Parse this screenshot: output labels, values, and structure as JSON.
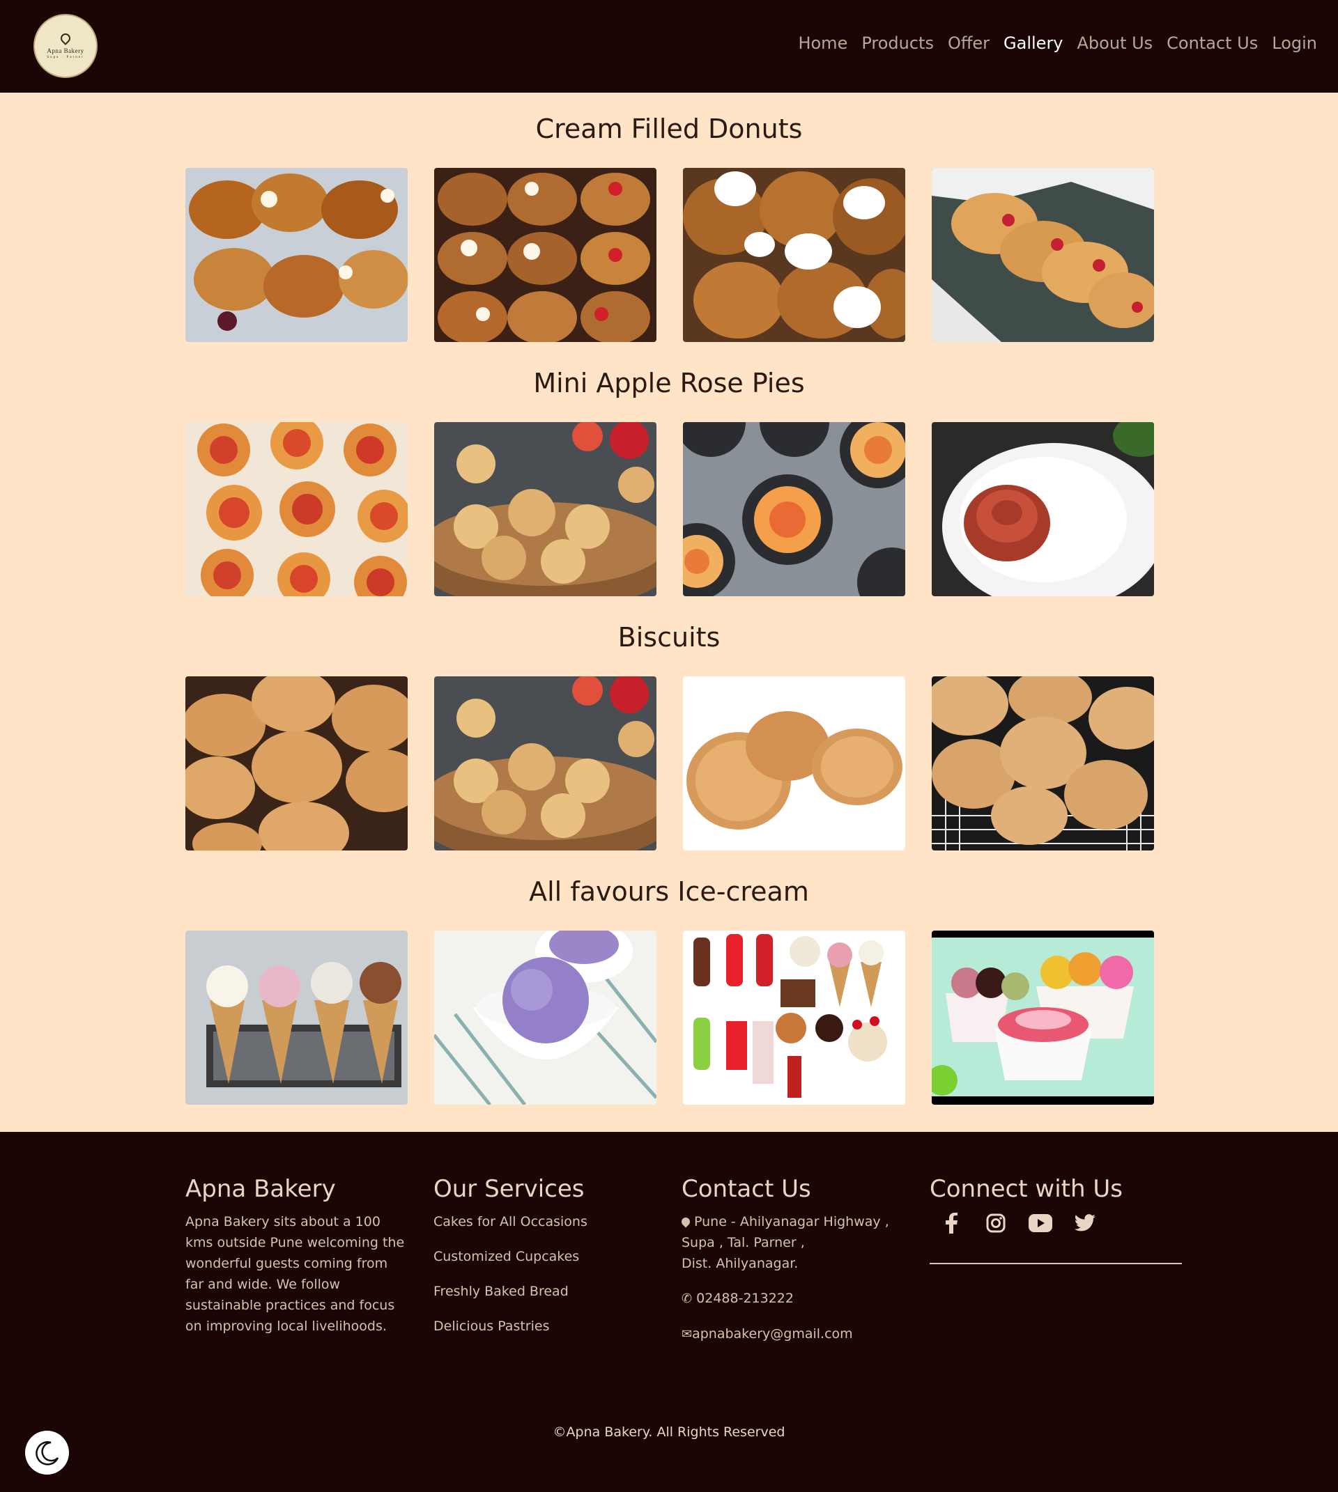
{
  "nav": {
    "logo_text": "Apna Bakery",
    "logo_subtext": "Supa · Parner",
    "links": [
      "Home",
      "Products",
      "Offer",
      "Gallery",
      "About Us",
      "Contact Us",
      "Login"
    ],
    "active": "Gallery"
  },
  "gallery": {
    "sections": [
      {
        "title": "Cream Filled Donuts"
      },
      {
        "title": "Mini Apple Rose Pies"
      },
      {
        "title": "Biscuits"
      },
      {
        "title": "All favours Ice-cream"
      }
    ]
  },
  "footer": {
    "about": {
      "title": "Apna Bakery",
      "text": "Apna Bakery sits about a 100 kms outside Pune welcoming the wonderful guests coming from far and wide. We follow sustainable practices and focus on improving local livelihoods."
    },
    "services": {
      "title": "Our Services",
      "items": [
        "Cakes for All Occasions",
        "Customized Cupcakes",
        "Freshly Baked Bread",
        "Delicious Pastries"
      ]
    },
    "contact": {
      "title": "Contact Us",
      "address_line1": "Pune - Ahilyanagar Highway ,",
      "address_line2": "Supa , Tal. Parner ,",
      "address_line3": "Dist. Ahilyanagar.",
      "phone": "02488-213222",
      "email": "apnabakery@gmail.com"
    },
    "connect": {
      "title": "Connect with Us",
      "icons": [
        "facebook-icon",
        "instagram-icon",
        "youtube-icon",
        "twitter-icon"
      ]
    },
    "copyright": "©Apna Bakery. All Rights Reserved"
  },
  "colors": {
    "navbar_bg": "#1c0505",
    "page_bg": "#ffe4c8",
    "nav_link": "#b9a697",
    "nav_active": "#ffffff"
  }
}
